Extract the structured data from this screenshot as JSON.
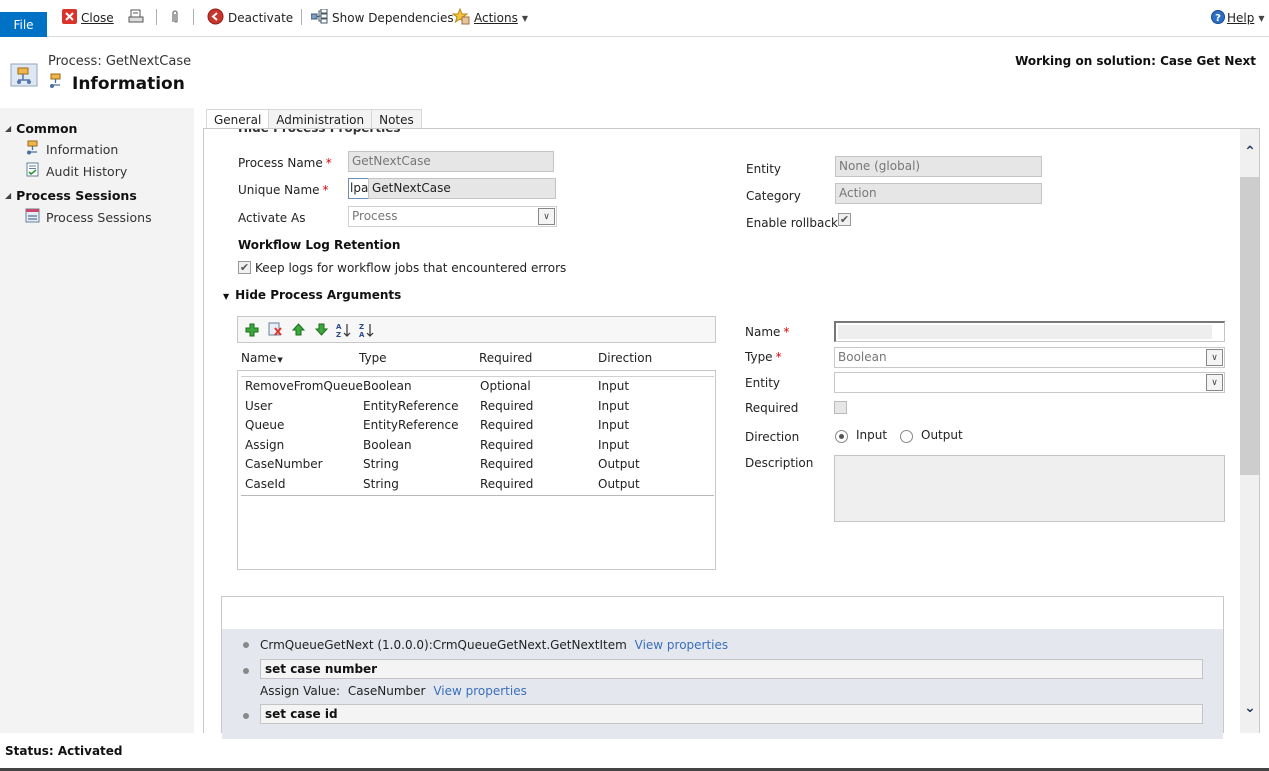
{
  "commandbar": {
    "file": "File",
    "close": "Close",
    "deactivate": "Deactivate",
    "show_dependencies": "Show Dependencies",
    "actions": "Actions",
    "help": "Help",
    "icons": [
      "close-icon",
      "print-icon",
      "attach-icon",
      "deactivate-icon",
      "dependencies-icon",
      "actions-icon",
      "help-icon"
    ]
  },
  "header": {
    "subtitle": "Process: GetNextCase",
    "title": "Information",
    "solution": "Working on solution: Case Get Next"
  },
  "leftnav": {
    "groups": [
      {
        "label": "Common",
        "items": [
          {
            "label": "Information",
            "icon": "process-icon"
          },
          {
            "label": "Audit History",
            "icon": "audit-history-icon"
          }
        ]
      },
      {
        "label": "Process Sessions",
        "items": [
          {
            "label": "Process Sessions",
            "icon": "process-sessions-icon"
          }
        ]
      }
    ]
  },
  "tabs": [
    {
      "label": "General",
      "active": true
    },
    {
      "label": "Administration",
      "active": false
    },
    {
      "label": "Notes",
      "active": false
    }
  ],
  "form": {
    "cut_section_title": "Hide Process Properties",
    "process_name_label": "Process Name",
    "process_name_value": "GetNextCase",
    "unique_name_label": "Unique Name",
    "unique_name_prefix": "lpa_",
    "unique_name_value": "GetNextCase",
    "activate_as_label": "Activate As",
    "activate_as_value": "Process",
    "entity_label": "Entity",
    "entity_value": "None (global)",
    "category_label": "Category",
    "category_value": "Action",
    "enable_rollback_label": "Enable rollback",
    "enable_rollback_checked": true,
    "log_retention_heading": "Workflow Log Retention",
    "keep_logs_label": "Keep logs for workflow jobs that encountered errors",
    "keep_logs_checked": true,
    "args_section_title": "Hide Process Arguments"
  },
  "arguments": {
    "columns": [
      "Name",
      "Type",
      "Required",
      "Direction"
    ],
    "rows": [
      {
        "name": "RemoveFromQueue",
        "type": "Boolean",
        "required": "Optional",
        "direction": "Input"
      },
      {
        "name": "User",
        "type": "EntityReference",
        "required": "Required",
        "direction": "Input"
      },
      {
        "name": "Queue",
        "type": "EntityReference",
        "required": "Required",
        "direction": "Input"
      },
      {
        "name": "Assign",
        "type": "Boolean",
        "required": "Required",
        "direction": "Input"
      },
      {
        "name": "CaseNumber",
        "type": "String",
        "required": "Required",
        "direction": "Output"
      },
      {
        "name": "CaseId",
        "type": "String",
        "required": "Required",
        "direction": "Output"
      }
    ]
  },
  "arg_detail": {
    "name_label": "Name",
    "name_value": "",
    "type_label": "Type",
    "type_value": "Boolean",
    "entity_label": "Entity",
    "entity_value": "",
    "required_label": "Required",
    "required_checked": false,
    "direction_label": "Direction",
    "direction_options": [
      "Input",
      "Output"
    ],
    "direction_selected": "Input",
    "description_label": "Description",
    "description_value": ""
  },
  "steps": {
    "step1_text": "CrmQueueGetNext (1.0.0.0):CrmQueueGetNext.GetNextItem",
    "view_properties": "View properties",
    "step2_title": "set case number",
    "step2_detail_label": "Assign Value:",
    "step2_detail_value": "CaseNumber",
    "step3_title": "set case id"
  },
  "status": "Status: Activated"
}
